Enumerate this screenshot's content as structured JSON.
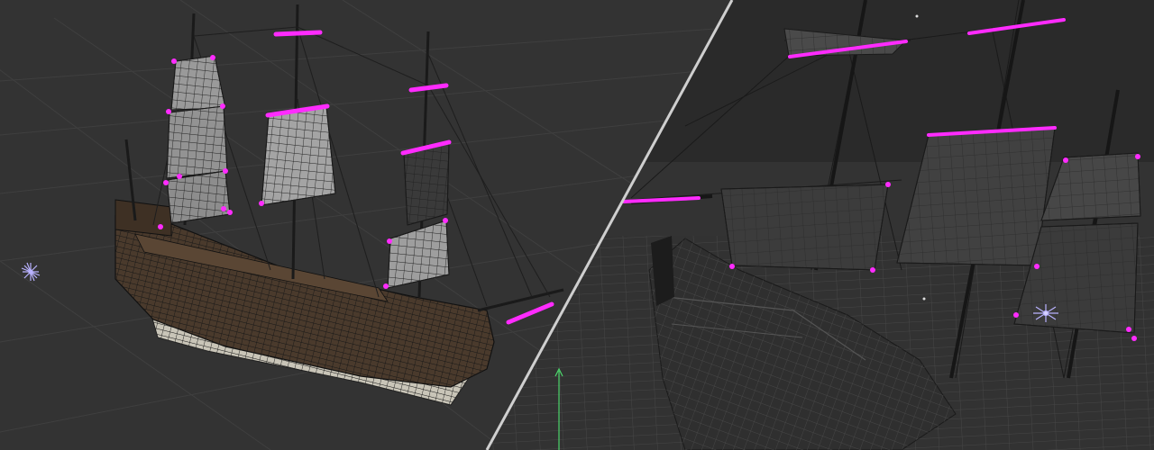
{
  "scene": {
    "layout": "split-viewport-diagonal",
    "colors": {
      "background_left": "#333333",
      "background_right": "#2a2a2a",
      "grid": "#3f3f3f",
      "ocean_mesh": "#4a4a4a",
      "hull_wood": "#4a3a2c",
      "hull_wire": "#141414",
      "sail": "#9a9a9a",
      "highlight": "#ff2bff",
      "divider": "#cfcfcf",
      "light_gizmo": "#b9b2ff",
      "axis_y": "#4cd66b"
    }
  },
  "viewports": [
    {
      "name": "shaded-wireframe",
      "model": "galleon-ship-icon",
      "icons": [
        "light-gizmo-icon"
      ]
    },
    {
      "name": "wireframe-closeup",
      "model": "galleon-ship-icon",
      "icons": [
        "light-gizmo-icon",
        "y-axis-icon"
      ]
    }
  ]
}
